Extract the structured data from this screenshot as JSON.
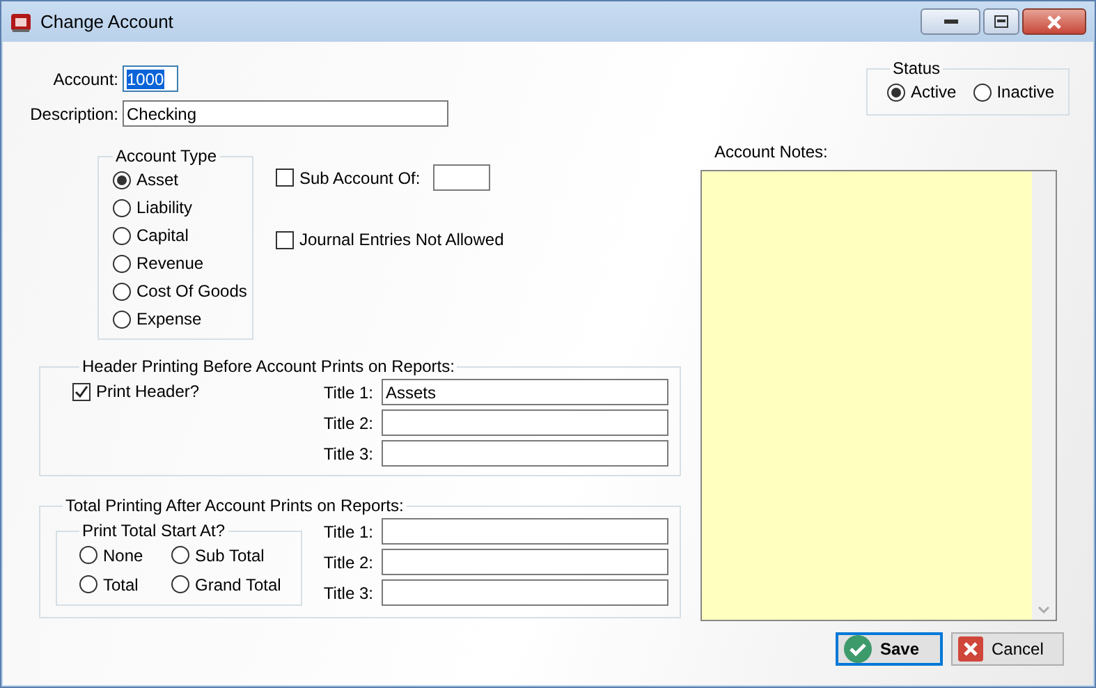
{
  "window": {
    "title": "Change Account"
  },
  "account": {
    "label": "Account:",
    "value": "1000",
    "text_selected": true
  },
  "description": {
    "label": "Description:",
    "value": "Checking"
  },
  "account_type": {
    "title": "Account Type",
    "options": [
      {
        "label": "Asset",
        "selected": true
      },
      {
        "label": "Liability",
        "selected": false
      },
      {
        "label": "Capital",
        "selected": false
      },
      {
        "label": "Revenue",
        "selected": false
      },
      {
        "label": "Cost Of Goods",
        "selected": false
      },
      {
        "label": "Expense",
        "selected": false
      }
    ]
  },
  "sub_account": {
    "label": "Sub Account Of:",
    "checked": false
  },
  "journal_entries": {
    "label": "Journal Entries Not Allowed",
    "checked": false
  },
  "header_printing": {
    "title": "Header Printing Before Account Prints on Reports:",
    "print_header": {
      "label": "Print Header?",
      "checked": true
    },
    "titles": [
      {
        "label": "Title 1:",
        "value": "Assets"
      },
      {
        "label": "Title 2:"
      },
      {
        "label": "Title 3:"
      }
    ]
  },
  "total_printing": {
    "title": "Total Printing After Account Prints on Reports:",
    "start_at": {
      "title": "Print Total Start At?",
      "options": [
        {
          "label": "None",
          "selected": false
        },
        {
          "label": "Sub Total",
          "selected": false
        },
        {
          "label": "Total",
          "selected": false
        },
        {
          "label": "Grand Total",
          "selected": false
        }
      ]
    },
    "titles": [
      {
        "label": "Title 1:"
      },
      {
        "label": "Title 2:"
      },
      {
        "label": "Title 3:"
      }
    ]
  },
  "status": {
    "title": "Status",
    "options": [
      {
        "label": "Active",
        "selected": true
      },
      {
        "label": "Inactive",
        "selected": false
      }
    ]
  },
  "notes": {
    "label": "Account Notes:"
  },
  "buttons": [
    {
      "kind": "save",
      "label": "Save",
      "default": true
    },
    {
      "kind": "cancel",
      "label": "Cancel",
      "default": false
    }
  ]
}
